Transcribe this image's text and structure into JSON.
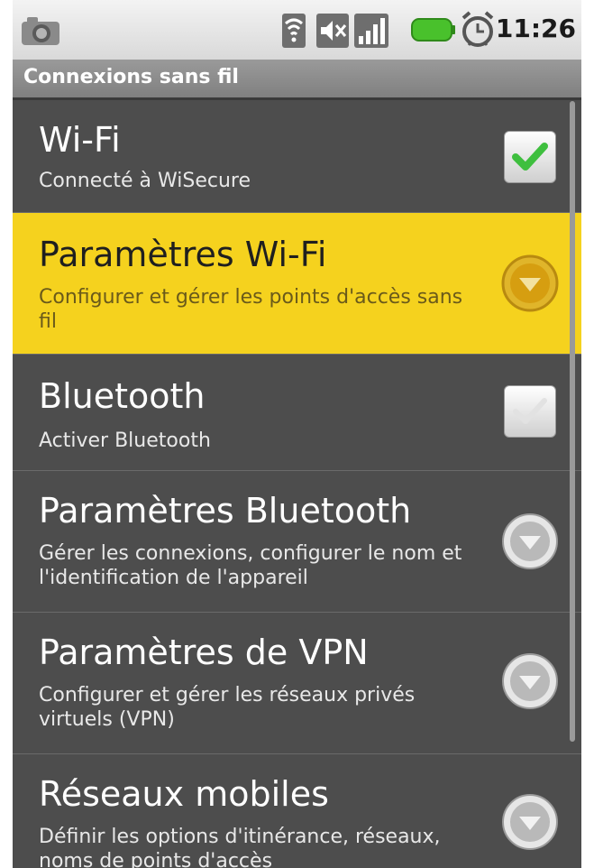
{
  "status_bar": {
    "icons": [
      "camera-icon",
      "wifi-icon",
      "mute-icon",
      "signal-icon",
      "battery-icon",
      "alarm-icon"
    ],
    "time": "11:26"
  },
  "title_bar": {
    "title": "Connexions sans fil"
  },
  "colors": {
    "highlight": "#f5d21e",
    "background": "#4d4d4d",
    "check": "#3fbf3f"
  },
  "items": [
    {
      "title": "Wi-Fi",
      "subtitle": "Connecté à WiSecure",
      "control": "checkbox",
      "checked": true
    },
    {
      "title": "Paramètres Wi-Fi",
      "subtitle": "Configurer et gérer les points d'accès sans fil",
      "control": "arrow",
      "selected": true
    },
    {
      "title": "Bluetooth",
      "subtitle": "Activer Bluetooth",
      "control": "checkbox",
      "checked": false
    },
    {
      "title": "Paramètres Bluetooth",
      "subtitle": "Gérer les connexions, configurer le nom et l'identification de l'appareil",
      "control": "arrow"
    },
    {
      "title": "Paramètres de VPN",
      "subtitle": "Configurer et gérer les réseaux privés virtuels (VPN)",
      "control": "arrow"
    },
    {
      "title": "Réseaux mobiles",
      "subtitle": "Définir les options d'itinérance, réseaux, noms de points d'accès",
      "control": "arrow"
    }
  ]
}
